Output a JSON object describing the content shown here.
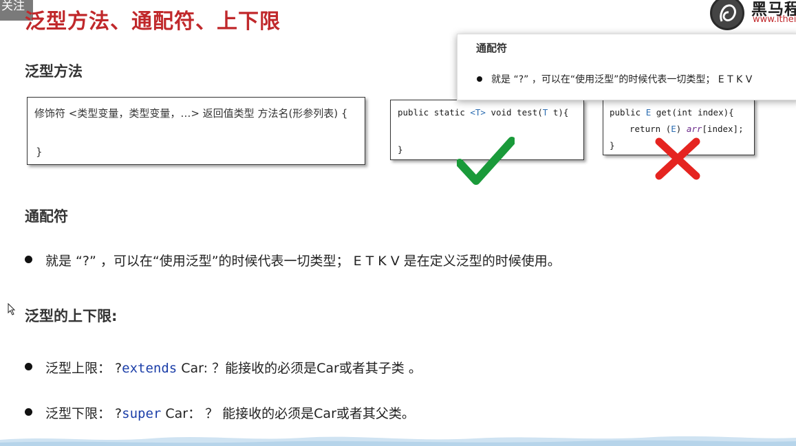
{
  "overlay": {
    "follow_label": "关注"
  },
  "slide": {
    "title": "泛型方法、通配符、上下限"
  },
  "logo": {
    "name": "黑马程",
    "url": "www.ithei"
  },
  "sections": {
    "generic_method": {
      "heading": "泛型方法",
      "syntax_box": {
        "line": "修饰符 <类型变量，类型变量，…> 返回值类型 方法名(形参列表) {",
        "close": "}"
      },
      "good_example": {
        "line1_public": "public",
        "line1_static": "static",
        "line1_typeparam": "<T>",
        "line1_void": "void",
        "line1_rest_a": "test(",
        "line1_param_type": "T",
        "line1_rest_b": "t){",
        "line2": "}"
      },
      "bad_example": {
        "line1_public": "public",
        "line1_type": "E",
        "line1_get": "get(",
        "line1_int": "int",
        "line1_rest": "index){",
        "line2_return": "return",
        "line2_cast_a": "(",
        "line2_cast_type": "E",
        "line2_cast_b": ")",
        "line2_arr": "arr",
        "line2_rest": "[index];",
        "line3": "}"
      }
    },
    "wildcard": {
      "heading": "通配符",
      "bullet": "就是 “?” ，可以在“使用泛型”的时候代表一切类型； E T K V 是在定义泛型的时候使用。"
    },
    "bounds": {
      "heading": "泛型的上下限:",
      "upper": {
        "label": "泛型上限： ?",
        "keyword": "extends",
        "rest": " Car: ？能接收的必须是Car或者其子类 。"
      },
      "lower": {
        "label": "泛型下限： ?",
        "keyword": "super",
        "rest": " Car： ？ 能接收的必须是Car或者其父类。"
      }
    }
  },
  "popup": {
    "title": "通配符",
    "text": "就是 “?” ，可以在“使用泛型”的时候代表一切类型； E T K V"
  },
  "colors": {
    "title_red": "#c0282b",
    "check_green": "#1a9a3a",
    "cross_red": "#e52420",
    "keyword_blue": "#1b3ea8"
  }
}
